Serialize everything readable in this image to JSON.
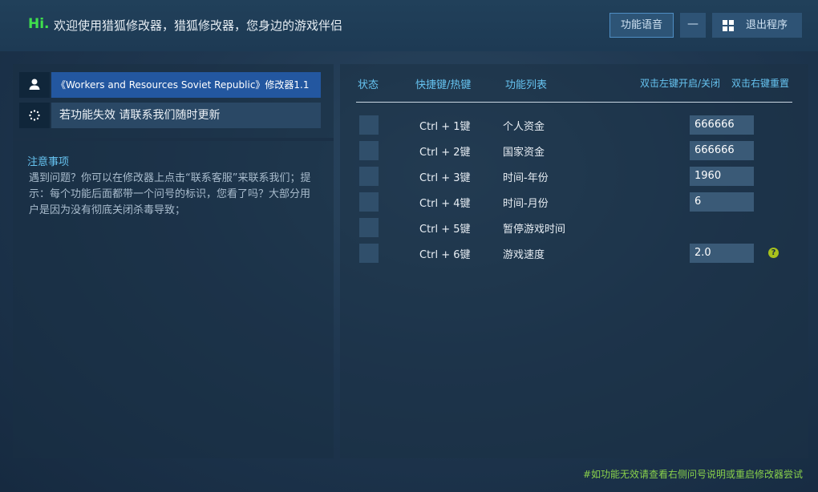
{
  "header": {
    "greeting": "Hi.",
    "welcome": "欢迎使用猎狐修改器，猎狐修改器，您身边的游戏伴侣",
    "voice_button": "功能语音",
    "minimize_button": "—",
    "exit_button": "退出程序"
  },
  "left": {
    "game_title": "《Workers and Resources Soviet Republic》修改器1.1",
    "notice": "若功能失效  请联系我们随时更新",
    "notes_title": "注意事项",
    "notes_body": "遇到问题？你可以在修改器上点击“联系客服”来联系我们；提示：每个功能后面都带一个问号的标识，您看了吗？大部分用户是因为没有彻底关闭杀毒导致；"
  },
  "table": {
    "columns": {
      "status": "状态",
      "hotkey": "快捷键/热键",
      "function": "功能列表"
    },
    "hint_toggle": "双击左键开启/关闭",
    "hint_reset": "双击右键重置",
    "rows": [
      {
        "hotkey": "Ctrl  +  1键",
        "name": "个人资金",
        "value": "666666",
        "has_input": true,
        "has_help": false
      },
      {
        "hotkey": "Ctrl  +  2键",
        "name": "国家资金",
        "value": "666666",
        "has_input": true,
        "has_help": false
      },
      {
        "hotkey": "Ctrl  +  3键",
        "name": "时间-年份",
        "value": "1960",
        "has_input": true,
        "has_help": false
      },
      {
        "hotkey": "Ctrl  +  4键",
        "name": "时间-月份",
        "value": "6",
        "has_input": true,
        "has_help": false
      },
      {
        "hotkey": "Ctrl  +  5键",
        "name": "暂停游戏时间",
        "value": "",
        "has_input": false,
        "has_help": false
      },
      {
        "hotkey": "Ctrl  +  6键",
        "name": "游戏速度",
        "value": "2.0",
        "has_input": true,
        "has_help": true
      }
    ]
  },
  "footer": {
    "note": "#如功能无效请查看右侧问号说明或重启修改器尝试"
  },
  "colors": {
    "accent_blue": "#66c3f0",
    "hi_green": "#3fe04c",
    "footer_green": "#89d14b",
    "selected_bg": "#2357a0"
  }
}
